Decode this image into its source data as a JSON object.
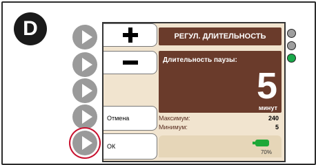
{
  "badge": {
    "letter": "D"
  },
  "screen": {
    "title": "РЕГУЛ. ДЛИТЕЛЬНОСТЬ",
    "value_label": "Длительность паузы:",
    "value": "5",
    "unit": "минут",
    "max_label": "Максимум:",
    "max_value": "240",
    "min_label": "Минимум:",
    "min_value": "5",
    "battery_percent": "70%"
  },
  "soft_keys": {
    "plus_icon": "plus-icon",
    "minus_icon": "minus-icon",
    "cancel_label": "Отмена",
    "ok_label": "ОК"
  },
  "side_buttons": [
    "softkey-1",
    "softkey-2",
    "softkey-3",
    "softkey-4",
    "softkey-5"
  ],
  "highlighted_button": "softkey-5",
  "leds": [
    {
      "name": "led-1",
      "color": "#9e9e9e"
    },
    {
      "name": "led-2",
      "color": "#9e9e9e"
    },
    {
      "name": "led-3",
      "color": "#19a84a"
    }
  ],
  "colors": {
    "panel_brown": "#6a3b2b",
    "screen_bg": "#f1e4cf",
    "highlight_red": "#c8102e",
    "battery_green": "#1ea838"
  }
}
